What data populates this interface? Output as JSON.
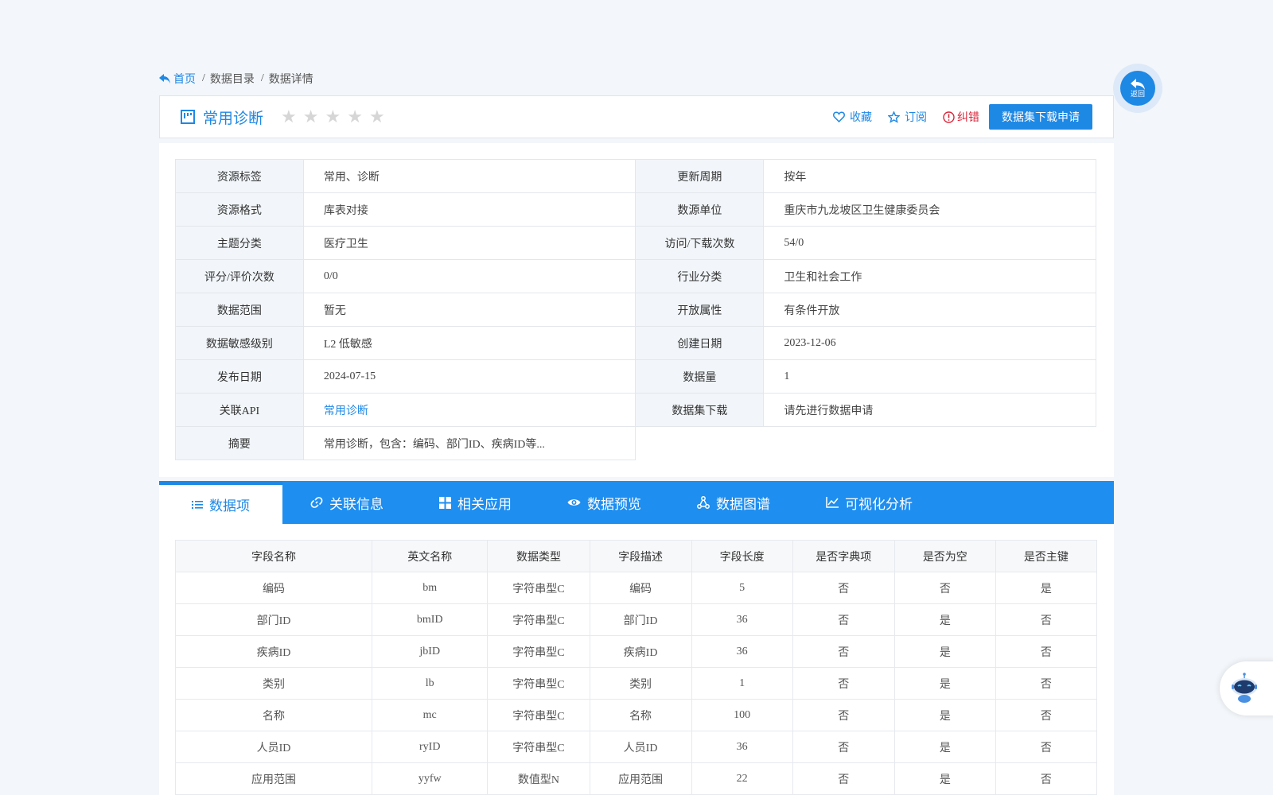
{
  "breadcrumb": {
    "home": "首页",
    "catalog": "数据目录",
    "detail": "数据详情",
    "separator": "/"
  },
  "header": {
    "title": "常用诊断",
    "rating_stars": 5,
    "rating_value": 0,
    "favorite": "收藏",
    "subscribe": "订阅",
    "report_error": "纠错",
    "apply_button": "数据集下载申请"
  },
  "info": {
    "rows": [
      {
        "l1": "资源标签",
        "v1": "常用、诊断",
        "l2": "更新周期",
        "v2": "按年"
      },
      {
        "l1": "资源格式",
        "v1": "库表对接",
        "l2": "数源单位",
        "v2": "重庆市九龙坡区卫生健康委员会"
      },
      {
        "l1": "主题分类",
        "v1": "医疗卫生",
        "l2": "访问/下载次数",
        "v2": "54/0"
      },
      {
        "l1": "评分/评价次数",
        "v1": "0/0",
        "l2": "行业分类",
        "v2": "卫生和社会工作"
      },
      {
        "l1": "数据范围",
        "v1": "暂无",
        "l2": "开放属性",
        "v2": "有条件开放"
      },
      {
        "l1": "数据敏感级别",
        "v1": "L2 低敏感",
        "l2": "创建日期",
        "v2": "2023-12-06"
      },
      {
        "l1": "发布日期",
        "v1": "2024-07-15",
        "l2": "数据量",
        "v2": "1"
      },
      {
        "l1": "关联API",
        "v1": "常用诊断",
        "l2": "数据集下载",
        "v2": "请先进行数据申请"
      },
      {
        "l1": "摘要",
        "v1": "常用诊断，包含：编码、部门ID、疾病ID等..."
      }
    ]
  },
  "tabs": [
    {
      "label": "数据项",
      "icon": "list-icon"
    },
    {
      "label": "关联信息",
      "icon": "link-icon"
    },
    {
      "label": "相关应用",
      "icon": "grid-icon"
    },
    {
      "label": "数据预览",
      "icon": "eye-icon"
    },
    {
      "label": "数据图谱",
      "icon": "graph-icon"
    },
    {
      "label": "可视化分析",
      "icon": "line-chart-icon"
    }
  ],
  "fields": {
    "headers": [
      "字段名称",
      "英文名称",
      "数据类型",
      "字段描述",
      "字段长度",
      "是否字典项",
      "是否为空",
      "是否主键"
    ],
    "rows": [
      [
        "编码",
        "bm",
        "字符串型C",
        "编码",
        "5",
        "否",
        "否",
        "是"
      ],
      [
        "部门ID",
        "bmID",
        "字符串型C",
        "部门ID",
        "36",
        "否",
        "是",
        "否"
      ],
      [
        "疾病ID",
        "jbID",
        "字符串型C",
        "疾病ID",
        "36",
        "否",
        "是",
        "否"
      ],
      [
        "类别",
        "lb",
        "字符串型C",
        "类别",
        "1",
        "否",
        "是",
        "否"
      ],
      [
        "名称",
        "mc",
        "字符串型C",
        "名称",
        "100",
        "否",
        "是",
        "否"
      ],
      [
        "人员ID",
        "ryID",
        "字符串型C",
        "人员ID",
        "36",
        "否",
        "是",
        "否"
      ],
      [
        "应用范围",
        "yyfw",
        "数值型N",
        "应用范围",
        "22",
        "否",
        "是",
        "否"
      ]
    ]
  },
  "float": {
    "back_label": "返回"
  },
  "colors": {
    "accent": "#1e88e5",
    "tabbar": "#1e8ef0",
    "error": "#d9263a"
  }
}
